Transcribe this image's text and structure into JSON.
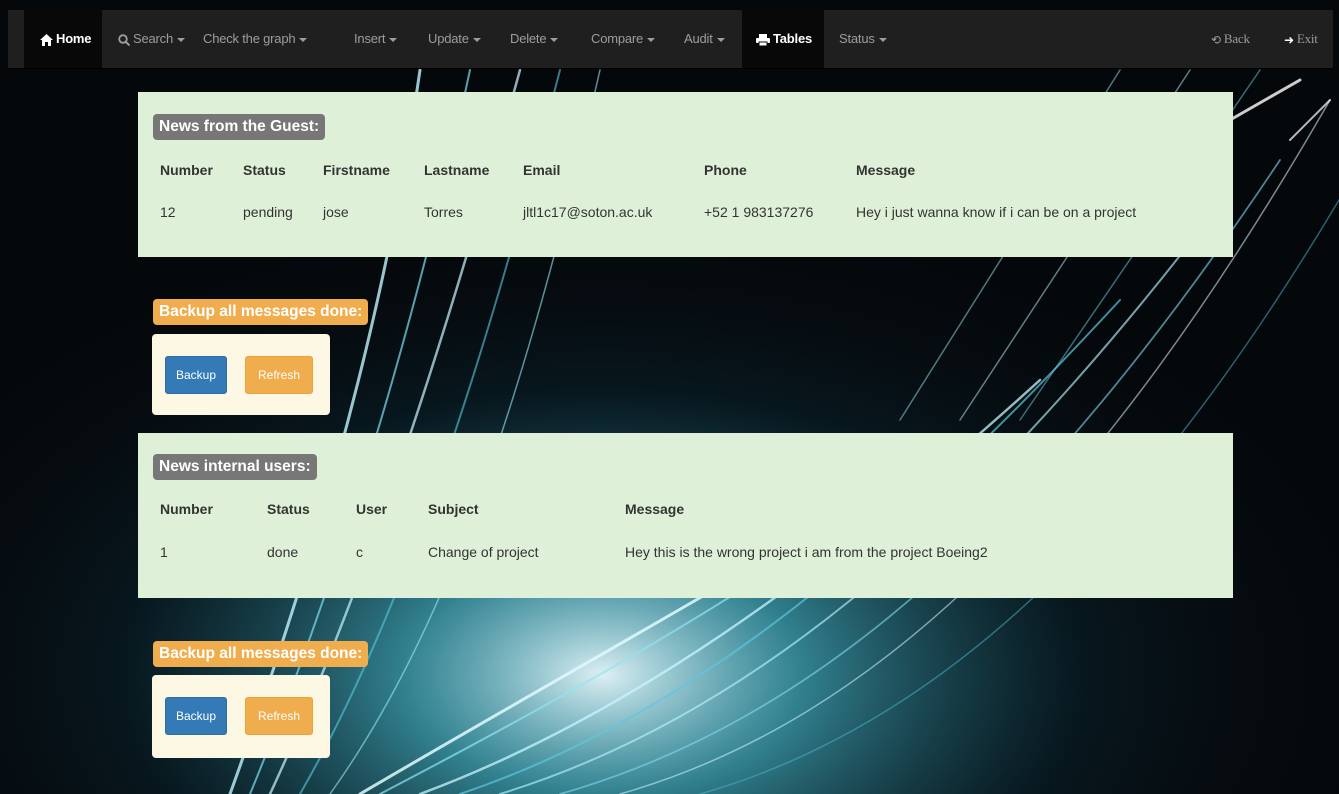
{
  "nav": {
    "home": "Home",
    "search": "Search",
    "check_graph": "Check the graph",
    "insert": "Insert",
    "update": "Update",
    "delete": "Delete",
    "compare": "Compare",
    "audit": "Audit",
    "tables": "Tables",
    "status": "Status",
    "back": "Back",
    "exit": "Exit"
  },
  "guest": {
    "title": "News from the Guest:",
    "headers": [
      "Number",
      "Status",
      "Firstname",
      "Lastname",
      "Email",
      "Phone",
      "Message"
    ],
    "rows": [
      [
        "12",
        "pending",
        "jose",
        "Torres",
        "jltl1c17@soton.ac.uk",
        "+52 1 983137276",
        "Hey i just wanna know if i can be on a project"
      ]
    ]
  },
  "backup1": {
    "title": "Backup all messages done:",
    "backup_label": "Backup",
    "refresh_label": "Refresh"
  },
  "internal": {
    "title": "News internal users:",
    "headers": [
      "Number",
      "Status",
      "User",
      "Subject",
      "Message"
    ],
    "rows": [
      [
        "1",
        "done",
        "c",
        "Change of project",
        "Hey this is the wrong project i am from the project Boeing2"
      ]
    ]
  },
  "backup2": {
    "title": "Backup all messages done:",
    "backup_label": "Backup",
    "refresh_label": "Refresh"
  },
  "colors": {
    "navbar": "#1f1f1f",
    "panel": "#dff0d8",
    "label_gray": "#777777",
    "label_orange": "#f0ad4e",
    "btn_blue": "#337ab7",
    "btn_orange": "#f0ad4e",
    "btn_box": "#fcf8e3"
  },
  "icons": {
    "home": "home-icon",
    "search": "search-icon",
    "tables": "print-icon",
    "back": "back-icon",
    "exit": "exit-icon"
  }
}
